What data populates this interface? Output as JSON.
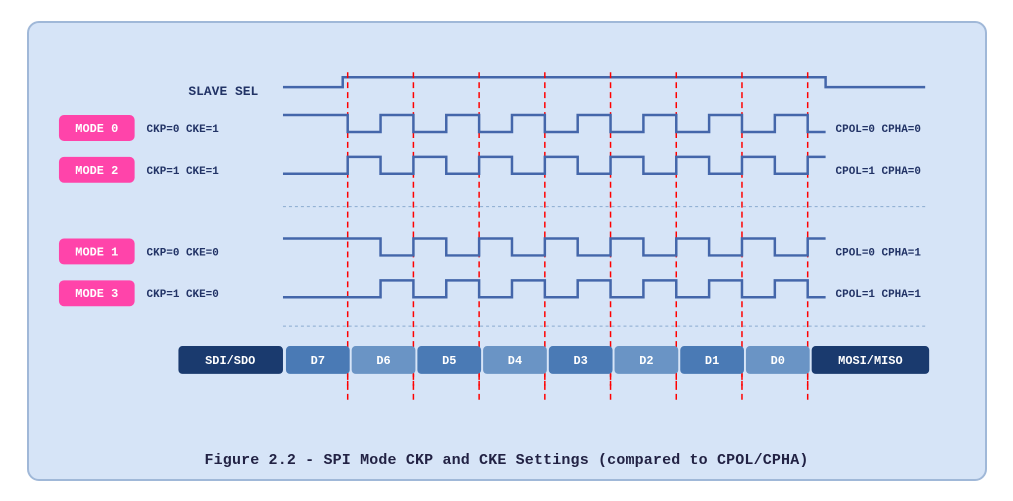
{
  "caption": "Figure 2.2 - SPI Mode CKP and CKE Settings (compared to CPOL/CPHA)",
  "diagram": {
    "slave_sel_label": "SLAVE SEL",
    "modes": [
      {
        "label": "MODE 0",
        "param": "CKP=0  CKE=1",
        "right": "CPOL=0  CPHA=0",
        "type": "high_start"
      },
      {
        "label": "MODE 2",
        "param": "CKP=1  CKE=1",
        "right": "CPOL=1  CPHA=0",
        "type": "low_start"
      },
      {
        "label": "MODE 1",
        "param": "CKP=0  CKE=0",
        "right": "CPOL=0  CPHA=1",
        "type": "high_start_phase"
      },
      {
        "label": "MODE 3",
        "param": "CKP=1  CKE=0",
        "right": "CPOL=1  CPHA=1",
        "type": "low_start_phase"
      }
    ],
    "data_labels": [
      "SDI/SDO",
      "D7",
      "D6",
      "D5",
      "D4",
      "D3",
      "D2",
      "D1",
      "D0",
      "MOSI/MISO"
    ],
    "red_dashes_x": [
      310,
      345,
      380,
      415,
      450,
      485,
      520,
      555,
      590,
      625
    ]
  }
}
